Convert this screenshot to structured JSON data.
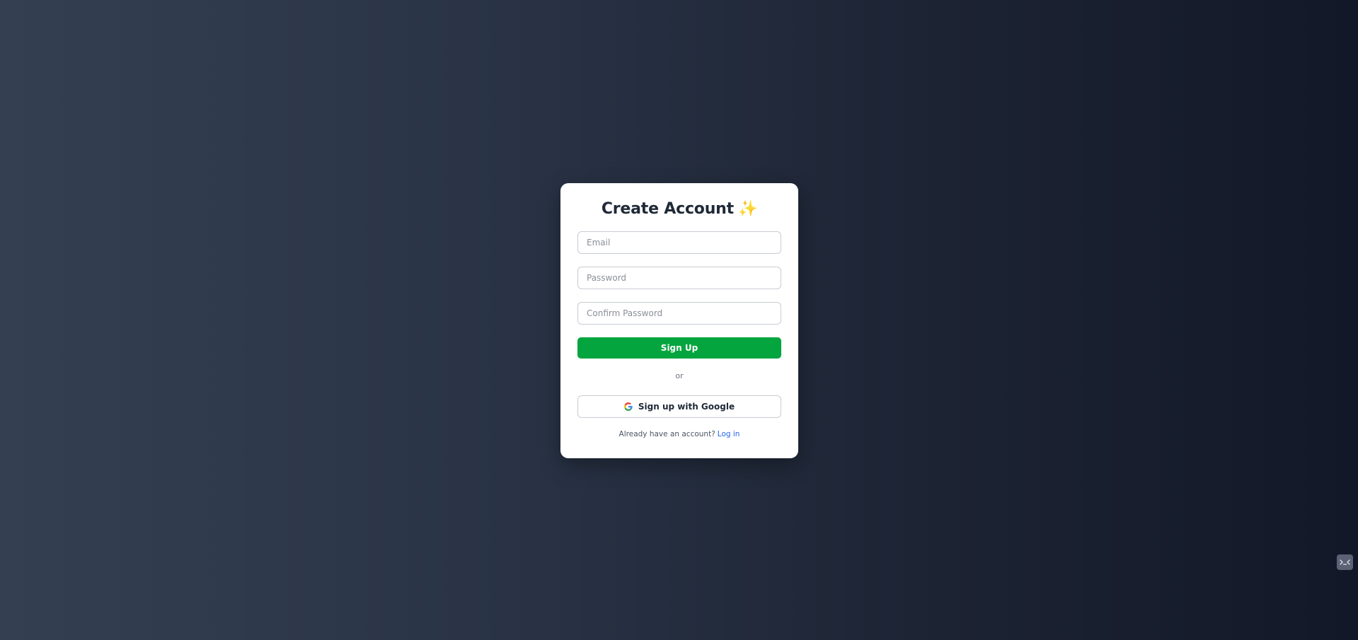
{
  "signup": {
    "title": "Create Account",
    "title_icon": "sparkles-icon",
    "email": {
      "value": "",
      "placeholder": "Email"
    },
    "password": {
      "value": "",
      "placeholder": "Password"
    },
    "confirm_password": {
      "value": "",
      "placeholder": "Confirm Password"
    },
    "submit_label": "Sign Up",
    "separator": "or",
    "google_label": "Sign up with Google",
    "google_icon": "google-icon",
    "footer_text": "Already have an account?",
    "login_link": "Log in"
  },
  "colors": {
    "primary_button": "#04a53e",
    "link": "#2563eb",
    "title_text": "#1f2937",
    "background_start": "#344052",
    "background_end": "#121828"
  },
  "devtool": {
    "icon": "devtools-toggle-icon"
  }
}
